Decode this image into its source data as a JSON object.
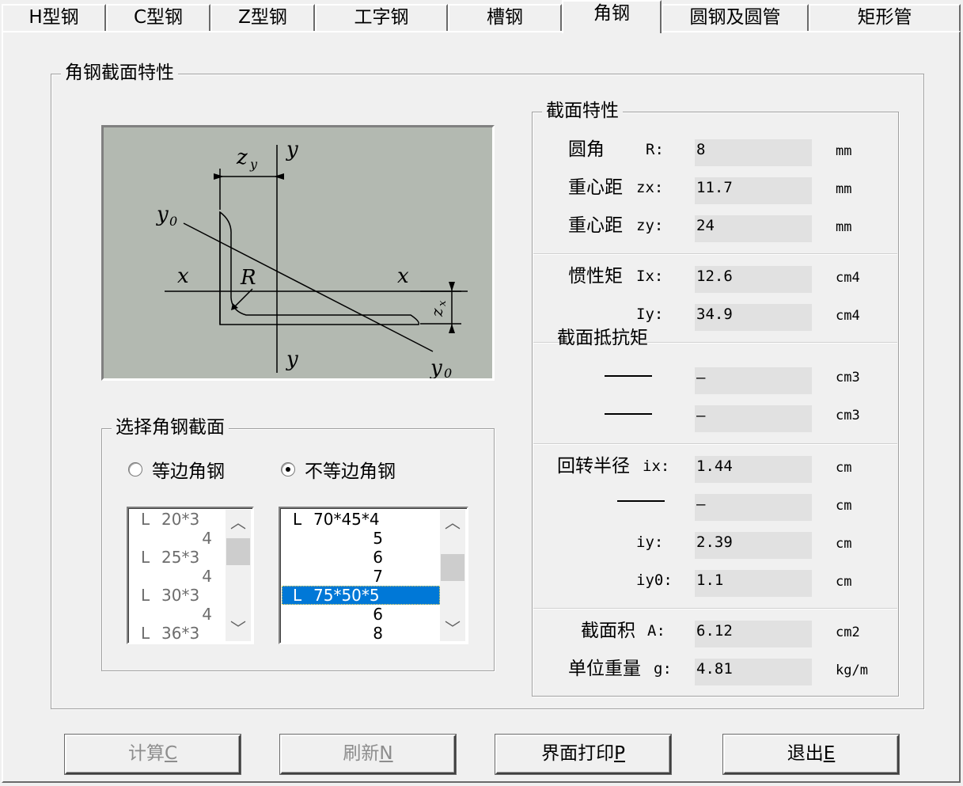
{
  "tabs": [
    {
      "label": "H型钢",
      "active": false
    },
    {
      "label": "C型钢",
      "active": false
    },
    {
      "label": "Z型钢",
      "active": false
    },
    {
      "label": "工字钢",
      "active": false
    },
    {
      "label": "槽钢",
      "active": false
    },
    {
      "label": "角钢",
      "active": true
    },
    {
      "label": "圆钢及圆管",
      "active": false
    },
    {
      "label": "矩形管",
      "active": false
    }
  ],
  "main_group": {
    "title": "角钢截面特性"
  },
  "diagram": {
    "label_zy": "z",
    "label_zy_sub": "y",
    "label_y_top": "y",
    "label_y_bottom": "y",
    "label_y0_top": "y",
    "label_y0_top_sub": "0",
    "label_y0_bottom": "y",
    "label_y0_bottom_sub": "0",
    "label_x_left": "x",
    "label_x_right": "x",
    "label_R": "R",
    "label_zx": "z",
    "label_zx_sub": "x"
  },
  "select_group": {
    "title": "选择角钢截面",
    "radio_equal": {
      "label": "等边角钢",
      "checked": false
    },
    "radio_unequal": {
      "label": "不等边角钢",
      "checked": true
    }
  },
  "list_equal": {
    "enabled": false,
    "items": [
      {
        "prefix": "L",
        "size": "20*3"
      },
      {
        "prefix": "",
        "size": "4"
      },
      {
        "prefix": "L",
        "size": "25*3"
      },
      {
        "prefix": "",
        "size": "4"
      },
      {
        "prefix": "L",
        "size": "30*3"
      },
      {
        "prefix": "",
        "size": "4"
      },
      {
        "prefix": "L",
        "size": "36*3"
      }
    ]
  },
  "list_unequal": {
    "enabled": true,
    "items": [
      {
        "prefix": "L",
        "size": "70*45*4",
        "selected": false
      },
      {
        "prefix": "",
        "size": "5",
        "selected": false
      },
      {
        "prefix": "",
        "size": "6",
        "selected": false
      },
      {
        "prefix": "",
        "size": "7",
        "selected": false
      },
      {
        "prefix": "L",
        "size": "75*50*5",
        "selected": true
      },
      {
        "prefix": "",
        "size": "6",
        "selected": false
      },
      {
        "prefix": "",
        "size": "8",
        "selected": false
      }
    ]
  },
  "props_group": {
    "title": "截面特性",
    "section_modulus_title": "截面抵抗矩",
    "rows": {
      "R": {
        "label": "圆角",
        "symbol": "R:",
        "value": "8",
        "unit": "mm"
      },
      "zx": {
        "label": "重心距",
        "symbol": "zx:",
        "value": "11.7",
        "unit": "mm"
      },
      "zy": {
        "label": "重心距",
        "symbol": "zy:",
        "value": "24",
        "unit": "mm"
      },
      "Ix": {
        "label": "惯性矩",
        "symbol": "Ix:",
        "value": "12.6",
        "unit": "cm4"
      },
      "Iy": {
        "label": "",
        "symbol": "Iy:",
        "value": "34.9",
        "unit": "cm4"
      },
      "W1": {
        "label": "",
        "symbol": "",
        "value": "—",
        "unit": "cm3"
      },
      "W2": {
        "label": "",
        "symbol": "",
        "value": "—",
        "unit": "cm3"
      },
      "ix": {
        "label": "回转半径",
        "symbol": "ix:",
        "value": "1.44",
        "unit": "cm"
      },
      "i2": {
        "label": "",
        "symbol": "",
        "value": "—",
        "unit": "cm"
      },
      "iy": {
        "label": "",
        "symbol": "iy:",
        "value": "2.39",
        "unit": "cm"
      },
      "iy0": {
        "label": "",
        "symbol": "iy0:",
        "value": "1.1",
        "unit": "cm"
      },
      "A": {
        "label": "截面积",
        "symbol": "A:",
        "value": "6.12",
        "unit": "cm2"
      },
      "g": {
        "label": "单位重量",
        "symbol": "g:",
        "value": "4.81",
        "unit": "kg/m"
      }
    }
  },
  "buttons": {
    "calc": {
      "label": "计算",
      "hotkey": "C",
      "enabled": false
    },
    "refresh": {
      "label": "刷新",
      "hotkey": "N",
      "enabled": false
    },
    "print": {
      "label": "界面打印",
      "hotkey": "P",
      "enabled": true
    },
    "exit": {
      "label": "退出",
      "hotkey": "E",
      "enabled": true
    }
  }
}
